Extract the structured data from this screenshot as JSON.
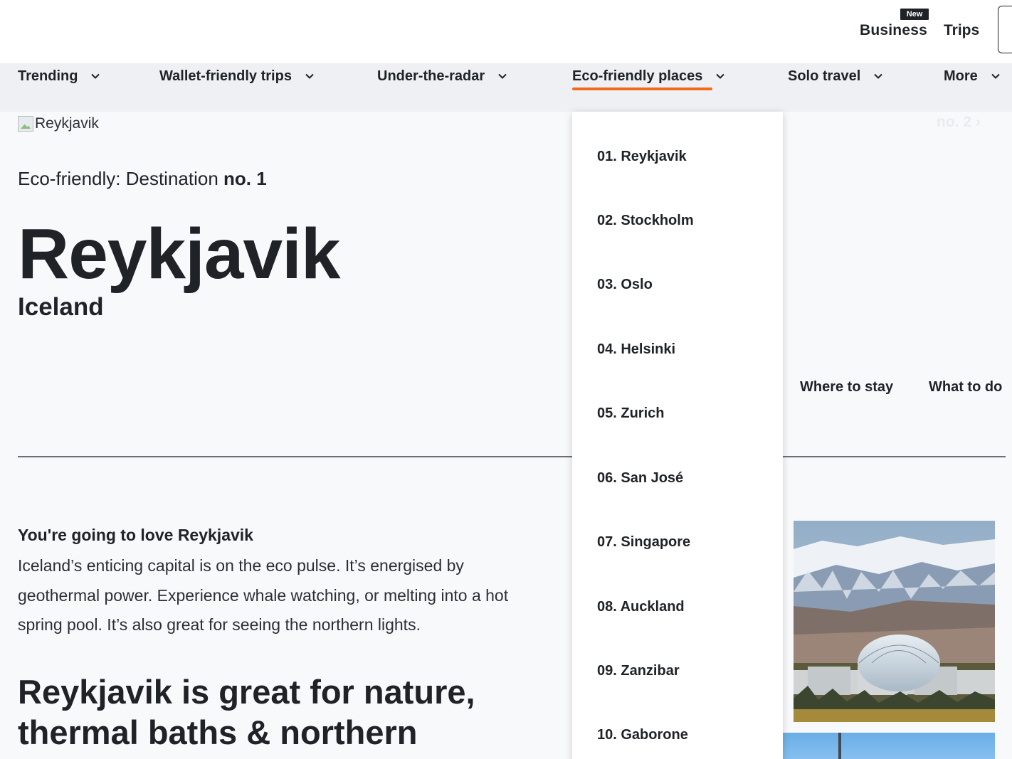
{
  "header": {
    "new_badge": "New",
    "business_label": "Business",
    "trips_label": "Trips"
  },
  "category_nav": {
    "items": [
      {
        "label": "Trending"
      },
      {
        "label": "Wallet-friendly trips"
      },
      {
        "label": "Under-the-radar"
      },
      {
        "label": "Eco-friendly places",
        "active": true
      },
      {
        "label": "Solo travel"
      },
      {
        "label": "More"
      }
    ],
    "accent_color": "#f26b1d"
  },
  "hero": {
    "image_alt": "Reykjavik",
    "kicker_prefix": "Eco-friendly: Destination ",
    "kicker_number": "no. 1",
    "next_destination": "no. 2",
    "title": "Reykjavik",
    "subtitle": "Iceland"
  },
  "sub_tabs": [
    {
      "label": "Where to stay"
    },
    {
      "label": "What to do"
    }
  ],
  "intro": {
    "title": "You're going to love Reykjavik",
    "body": "Iceland’s enticing capital is on the eco pulse. It’s energised by geothermal power. Experience whale watching, or melting into a hot spring pool. It’s also great for seeing the northern lights."
  },
  "section_heading": "Reykjavik is great for nature, thermal baths & northern",
  "dropdown": {
    "items": [
      {
        "label": "01. Reykjavik"
      },
      {
        "label": "02. Stockholm"
      },
      {
        "label": "03. Oslo"
      },
      {
        "label": "04. Helsinki"
      },
      {
        "label": "05. Zurich"
      },
      {
        "label": "06. San José"
      },
      {
        "label": "07. Singapore"
      },
      {
        "label": "08. Auckland"
      },
      {
        "label": "09. Zanzibar"
      },
      {
        "label": "10. Gaborone"
      }
    ]
  }
}
